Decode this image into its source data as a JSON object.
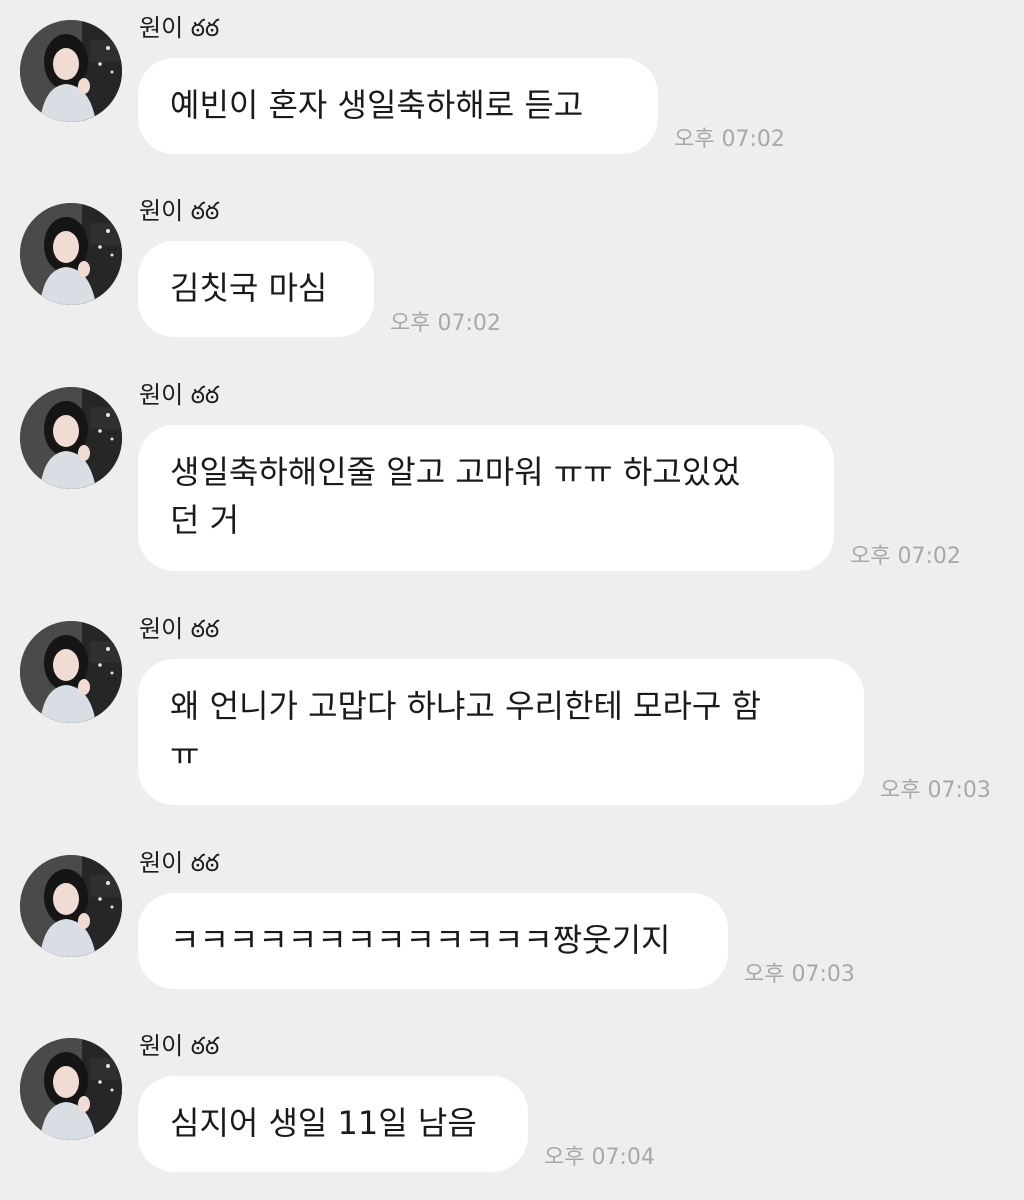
{
  "messages": [
    {
      "sender": "원이 ఠఠ",
      "text": "예빈이 혼자 생일축하해로 듣고",
      "time": "오후 07:02"
    },
    {
      "sender": "원이 ఠఠ",
      "text": "김칫국 마심",
      "time": "오후 07:02"
    },
    {
      "sender": "원이 ఠఠ",
      "text": "생일축하해인줄 알고 고마워 ㅠㅠ 하고있었\n던 거",
      "time": "오후 07:02"
    },
    {
      "sender": "원이 ఠఠ",
      "text": "왜 언니가 고맙다 하냐고 우리한테 모라구 함\nㅠ",
      "time": "오후 07:03"
    },
    {
      "sender": "원이 ఠఠ",
      "text": "ㅋㅋㅋㅋㅋㅋㅋㅋㅋㅋㅋㅋㅋ짱웃기지",
      "time": "오후 07:03"
    },
    {
      "sender": "원이 ఠఠ",
      "text": "심지어 생일 11일 남음",
      "time": "오후 07:04"
    }
  ],
  "colors": {
    "background": "#eeeeee",
    "bubble": "#ffffff",
    "text": "#1a1a1a",
    "timestamp": "#a8a8a8"
  },
  "icons": {
    "avatar": "profile-photo"
  }
}
